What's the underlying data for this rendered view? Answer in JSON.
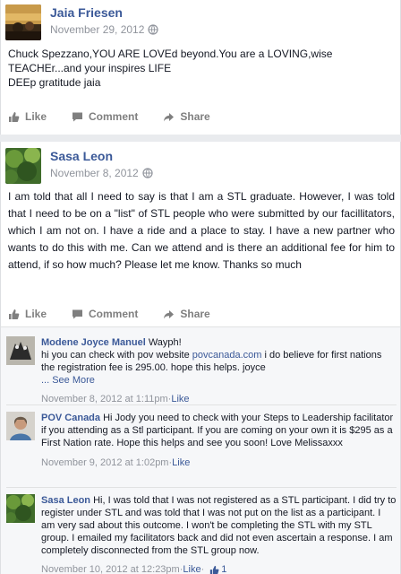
{
  "posts": [
    {
      "author": "Jaia Friesen",
      "date": "November 29, 2012",
      "text_line1": "Chuck Spezzano,YOU ARE LOVEd beyond.You are a LOVING,wise TEACHEr...and your inspires LIFE",
      "text_line2": "DEEp gratitude jaia",
      "actions": {
        "like": "Like",
        "comment": "Comment",
        "share": "Share"
      }
    },
    {
      "author": "Sasa Leon",
      "date": "November 8, 2012",
      "text": "I am told that all I need to say is that I am a STL graduate. However, I was told that I need to be on a \"list\" of STL people who were submitted by our facillitators, which I am not on. I have a ride and a place to stay. I have a new partner who wants to do this with me. Can we attend and is there an additional fee for him to attend, if so how much? Please let me know. Thanks so much",
      "actions": {
        "like": "Like",
        "comment": "Comment",
        "share": "Share"
      }
    }
  ],
  "comments": [
    {
      "author": "Modene Joyce Manuel",
      "text_a": "Wayph!",
      "text_b": "hi you can check with pov website ",
      "link": "povcanada.com",
      "text_c": " i do believe for first nations the registration fee is 295.00. hope this helps. joyce",
      "see_more": "... See More",
      "timestamp": "November 8, 2012 at 1:11pm",
      "sep": " · ",
      "like": "Like"
    },
    {
      "author": "POV Canada",
      "text": "Hi Jody you need to check with your Steps to Leadership facilitator if you attending as a Stl participant. If you are coming on your own it is $295 as a First Nation rate. Hope this helps and see you soon! Love Melissaxxx",
      "timestamp": "November 9, 2012 at 1:02pm",
      "sep": " · ",
      "like": "Like"
    },
    {
      "author": "Sasa Leon",
      "text": "Hi, I was told that I was not registered as a STL participant. I did try to register under STL and was told that I was not put on the list as a participant. I am very sad about this outcome. I won't be completing the STL with my STL group. I emailed my facilitators back and did not even ascertain a response. I am completely disconnected from the STL group now.",
      "timestamp": "November 10, 2012 at 12:23pm",
      "sep": " · ",
      "like": "Like",
      "sep2": " · ",
      "like_count": "1"
    }
  ]
}
